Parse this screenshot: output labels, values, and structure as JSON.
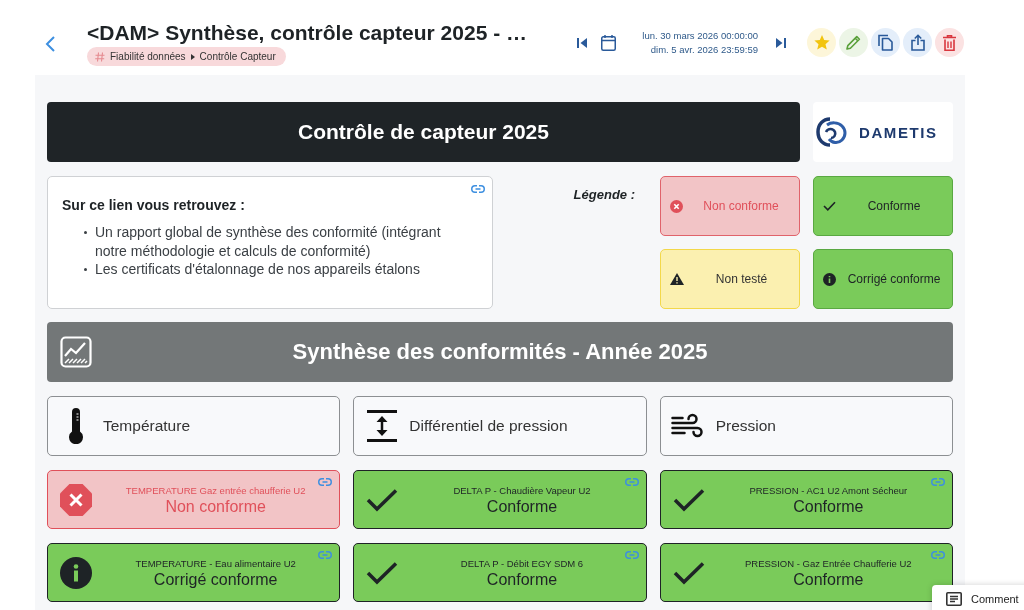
{
  "header": {
    "title": "<DAM> Synthèse, contrôle capteur 2025 - …",
    "breadcrumb": [
      "Fiabilité données",
      "Contrôle Capteur"
    ],
    "date_range": {
      "start": "lun. 30 mars 2026 00:00:00",
      "end": "dim. 5 avr. 2026 23:59:59"
    }
  },
  "banner": {
    "title": "Contrôle de capteur 2025",
    "logo_text": "DAMETIS"
  },
  "info_card": {
    "title": "Sur ce lien vous retrouvez :",
    "items": [
      "Un rapport global de synthèse des conformité (intégrant notre méthodologie et calculs de conformité)",
      "Les certificats d'étalonnage de nos appareils étalons"
    ]
  },
  "legend": {
    "label": "Légende :",
    "items": [
      {
        "label": "Non conforme",
        "kind": "nonconforme"
      },
      {
        "label": "Conforme",
        "kind": "conforme"
      },
      {
        "label": "Non testé",
        "kind": "nontest"
      },
      {
        "label": "Corrigé conforme",
        "kind": "corrige"
      }
    ]
  },
  "synthesis": {
    "title": "Synthèse des conformités - Année 2025",
    "columns": [
      {
        "label": "Température",
        "kind": "temperature",
        "sensors": [
          {
            "name": "TEMPERATURE Gaz entrée chaufferie U2",
            "status": "Non conforme",
            "kind": "nonconforme"
          },
          {
            "name": "TEMPERATURE - Eau alimentaire U2",
            "status": "Corrigé conforme",
            "kind": "corrige"
          }
        ]
      },
      {
        "label": "Différentiel de pression",
        "kind": "differential",
        "sensors": [
          {
            "name": "DELTA P - Chaudière Vapeur U2",
            "status": "Conforme",
            "kind": "conforme"
          },
          {
            "name": "DELTA P - Débit EGY SDM 6",
            "status": "Conforme",
            "kind": "conforme"
          }
        ]
      },
      {
        "label": "Pression",
        "kind": "pressure",
        "sensors": [
          {
            "name": "PRESSION - AC1 U2 Amont Sécheur",
            "status": "Conforme",
            "kind": "conforme"
          },
          {
            "name": "PRESSION - Gaz Entrée Chaufferie U2",
            "status": "Conforme",
            "kind": "conforme"
          }
        ]
      }
    ]
  },
  "comment_button": {
    "label": "Comment"
  }
}
